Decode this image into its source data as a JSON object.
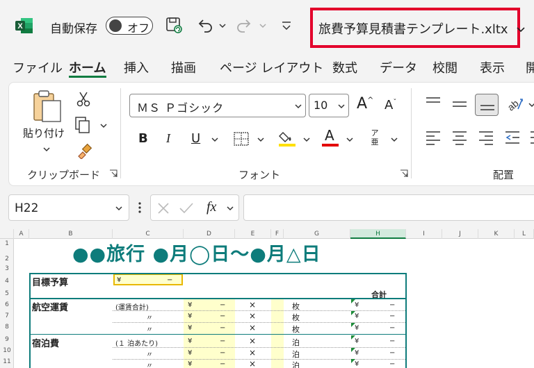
{
  "titlebar": {
    "autosave_label": "自動保存",
    "autosave_state": "オフ",
    "filename": "旅費予算見積書テンプレート.xltx",
    "filename_chevron": "∨"
  },
  "tabs": [
    {
      "label": "ファイル"
    },
    {
      "label": "ホーム"
    },
    {
      "label": "挿入"
    },
    {
      "label": "描画"
    },
    {
      "label": "ページ レイアウト"
    },
    {
      "label": "数式"
    },
    {
      "label": "データ"
    },
    {
      "label": "校閲"
    },
    {
      "label": "表示"
    },
    {
      "label": "開"
    }
  ],
  "ribbon": {
    "paste_label": "貼り付け",
    "clipboard_group": "クリップボード",
    "font_name": "ＭＳ Ｐゴシック",
    "font_size": "10",
    "font_group": "フォント",
    "align_group": "配置",
    "bold": "B",
    "italic": "I",
    "underline": "U",
    "phonetic_top": "ア",
    "phonetic_bottom": "亜",
    "grow_font": "A",
    "shrink_font": "A",
    "font_color_letter": "A"
  },
  "formula_bar": {
    "name_box": "H22",
    "fx": "fx",
    "formula": ""
  },
  "grid": {
    "columns": [
      "A",
      "B",
      "C",
      "D",
      "E",
      "F",
      "G",
      "H",
      "I",
      "J",
      "K",
      "L"
    ],
    "rows": [
      "1",
      "2",
      "3",
      "4",
      "5",
      "6",
      "7",
      "8",
      "9",
      "10",
      "11"
    ],
    "title": "●●旅行 ●月◯日～●月△日",
    "goal_label": "目標予算",
    "goal_yen": "¥",
    "goal_dash": "−",
    "total_header": "合計",
    "airfare_label": "航空運賃",
    "airfare_note": "(運賃合計)",
    "lodging_label": "宿泊費",
    "lodging_note": "(１ 泊あたり)",
    "ditto": "〃",
    "yen": "¥",
    "dash": "−",
    "times": "×",
    "unit_sheets": "枚",
    "unit_nights": "泊"
  },
  "colors": {
    "excel_green": "#107c41",
    "teal": "#0e7c7b",
    "highlight_red": "#e3002b",
    "input_yellow": "#ffffcc"
  }
}
